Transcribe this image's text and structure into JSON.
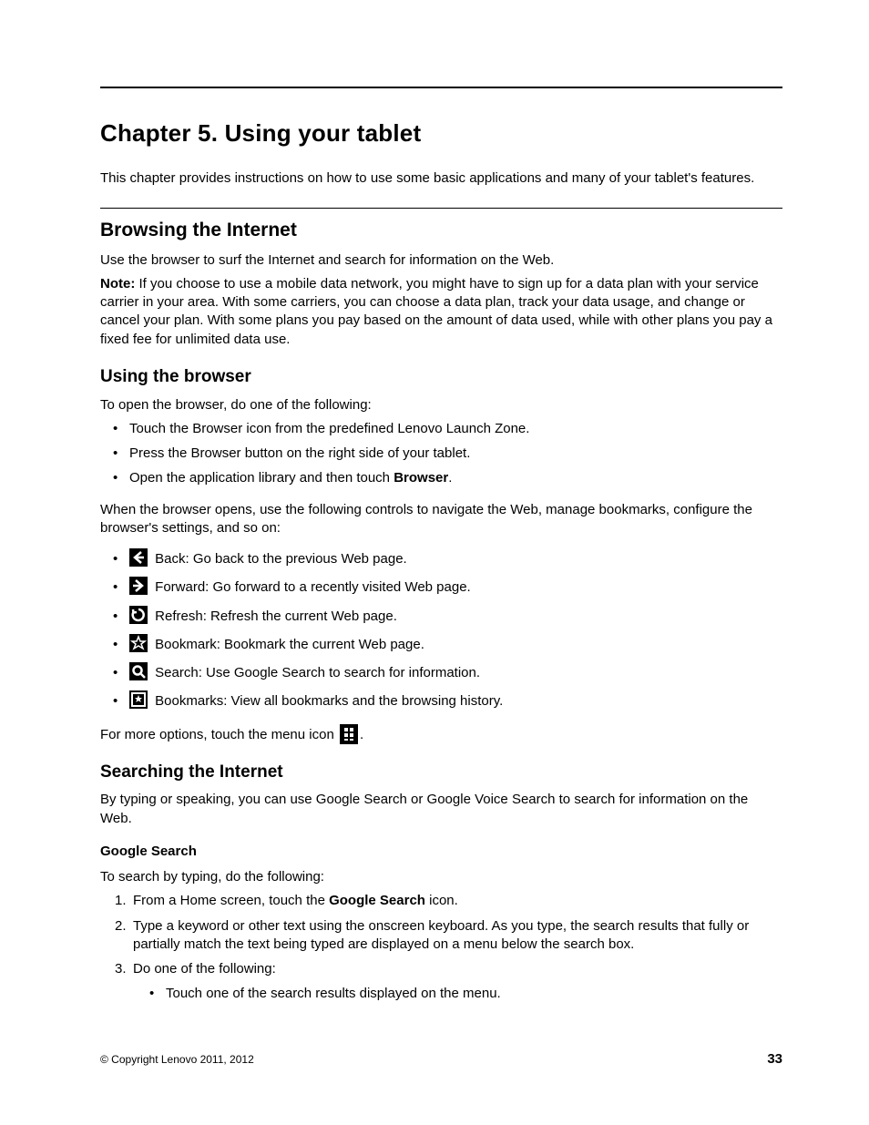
{
  "chapter_title": "Chapter 5.   Using your tablet",
  "intro": "This chapter provides instructions on how to use some basic applications and many of your tablet's features.",
  "section1": {
    "heading": "Browsing the Internet",
    "p1": "Use the browser to surf the Internet and search for information on the Web.",
    "note_label": "Note:",
    "note_body": " If you choose to use a mobile data network, you might have to sign up for a data plan with your service carrier in your area. With some carriers, you can choose a data plan, track your data usage, and change or cancel your plan. With some plans you pay based on the amount of data used, while with other plans you pay a fixed fee for unlimited data use."
  },
  "section2": {
    "heading": "Using the browser",
    "p1": "To open the browser, do one of the following:",
    "open_list": [
      "Touch the Browser icon from the predefined Lenovo Launch Zone.",
      "Press the Browser button on the right side of your tablet."
    ],
    "open_item3_pre": "Open the application library and then touch ",
    "open_item3_bold": "Browser",
    "open_item3_post": ".",
    "p2": "When the browser opens, use the following controls to navigate the Web, manage bookmarks, configure the browser's settings, and so on:",
    "controls": [
      {
        "name": "back-icon",
        "label": " Back: Go back to the previous Web page."
      },
      {
        "name": "forward-icon",
        "label": " Forward: Go forward to a recently visited Web page."
      },
      {
        "name": "refresh-icon",
        "label": " Refresh: Refresh the current Web page."
      },
      {
        "name": "bookmark-icon",
        "label": " Bookmark: Bookmark the current Web page."
      },
      {
        "name": "search-icon",
        "label": " Search: Use Google Search to search for information."
      },
      {
        "name": "bookmarks-icon",
        "label": " Bookmarks: View all bookmarks and the browsing history."
      }
    ],
    "more_options_pre": "For more options, touch the menu icon ",
    "more_options_post": "."
  },
  "section3": {
    "heading": "Searching the Internet",
    "p1": "By typing or speaking, you can use Google Search or Google Voice Search to search for information on the Web.",
    "sub_heading": "Google Search",
    "p2": "To search by typing, do the following:",
    "steps": {
      "s1_pre": "From a Home screen, touch the ",
      "s1_bold": "Google Search",
      "s1_post": " icon.",
      "s2": "Type a keyword or other text using the onscreen keyboard. As you type, the search results that fully or partially match the text being typed are displayed on a menu below the search box.",
      "s3": "Do one of the following:",
      "s3_sub1": "Touch one of the search results displayed on the menu."
    }
  },
  "footer": {
    "copyright": "© Copyright Lenovo 2011, 2012",
    "page_number": "33"
  }
}
